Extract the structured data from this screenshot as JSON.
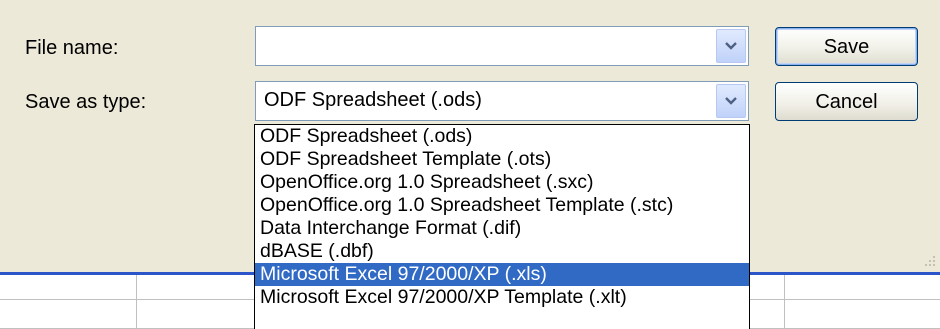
{
  "dialog": {
    "file_name_label": "File name:",
    "file_name_value": "",
    "save_as_type_label": "Save as type:",
    "save_as_type_value": "ODF Spreadsheet (.ods)",
    "save_button": "Save",
    "cancel_button": "Cancel"
  },
  "type_dropdown": {
    "options": [
      "ODF Spreadsheet (.ods)",
      "ODF Spreadsheet Template (.ots)",
      "OpenOffice.org 1.0 Spreadsheet (.sxc)",
      "OpenOffice.org 1.0 Spreadsheet Template (.stc)",
      "Data Interchange Format (.dif)",
      "dBASE (.dbf)",
      "Microsoft Excel 97/2000/XP (.xls)",
      "Microsoft Excel 97/2000/XP Template (.xlt)"
    ],
    "highlighted": "Microsoft Excel 97/2000/XP (.xls)"
  },
  "colors": {
    "dialog_bg": "#ece9d8",
    "highlight": "#316ac5",
    "sheet_rule": "#2c55c9"
  },
  "icons": [
    "chevron-down-icon",
    "resize-grip-icon"
  ]
}
